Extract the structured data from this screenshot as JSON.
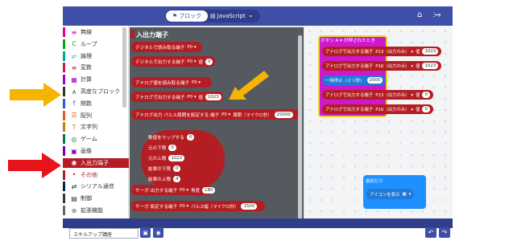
{
  "topbar": {
    "blocks_label": "ブロック",
    "js_label": "JavaScript",
    "home_icon": "home-icon",
    "share_icon": "share-icon"
  },
  "categories": [
    {
      "label": "無線",
      "color": "#e3008c",
      "icon": "bar-chart-icon"
    },
    {
      "label": "ループ",
      "color": "#00aa00",
      "icon": "loop-icon"
    },
    {
      "label": "論理",
      "color": "#00a4a6",
      "icon": "shuffle-icon"
    },
    {
      "label": "変数",
      "color": "#dc143c",
      "icon": "list-icon"
    },
    {
      "label": "計算",
      "color": "#9400d3",
      "icon": "grid-icon"
    },
    {
      "label": "高度なブロック",
      "color": "#333333",
      "icon": "chevron-up-icon"
    },
    {
      "label": "関数",
      "color": "#3455db",
      "icon": "function-icon"
    },
    {
      "label": "配列",
      "color": "#e65722",
      "icon": "array-icon"
    },
    {
      "label": "文字列",
      "color": "#b8860b",
      "icon": "text-icon"
    },
    {
      "label": "ゲーム",
      "color": "#007a4b",
      "icon": "game-icon"
    },
    {
      "label": "画像",
      "color": "#7600a8",
      "icon": "image-icon"
    },
    {
      "label": "入出力端子",
      "color": "#b41e23",
      "icon": "pin-icon"
    },
    {
      "label": "その他",
      "color": "#b41e23",
      "icon": "more-icon"
    },
    {
      "label": "シリアル通信",
      "color": "#002050",
      "icon": "serial-icon"
    },
    {
      "label": "制御",
      "color": "#333333",
      "icon": "control-icon"
    },
    {
      "label": "拡張機能",
      "color": "#666666",
      "icon": "plus-icon"
    }
  ],
  "flyout": {
    "title": "入出力端子",
    "blocks": [
      {
        "label": "デジタルで読み取る端子",
        "pin": "P0"
      },
      {
        "label": "デジタルで出力する端子",
        "pin": "P0",
        "suffix": "値",
        "value": "0"
      },
      {
        "label": "アナログ値を読み取る端子",
        "pin": "P0"
      },
      {
        "label": "アナログで出力する端子",
        "pin": "P0",
        "suffix": "値",
        "value": "1023"
      },
      {
        "label": "アナログ出力 パルス周期を設定する 端子",
        "pin": "P0",
        "suffix": "周期（マイクロ秒）",
        "value": "20000"
      },
      {
        "label": "サーボ 出力する端子",
        "pin": "P0",
        "suffix": "角度",
        "value": "180"
      },
      {
        "label": "サーボ 設定する端子",
        "pin": "P0",
        "suffix": "パルス幅（マイクロ秒）",
        "value": "1500"
      }
    ],
    "map_block": {
      "title": "数値をマップする",
      "value": "0",
      "rows": [
        {
          "label": "元の下限",
          "value": "0"
        },
        {
          "label": "元の上限",
          "value": "1023"
        },
        {
          "label": "結果の下限",
          "value": "0"
        },
        {
          "label": "結果の上限",
          "value": "4"
        }
      ]
    }
  },
  "workspace": {
    "event_label": "ボタン A ▾ が押されたとき",
    "event_blocks": [
      {
        "label": "アナログで出力する端子",
        "pin": "P13（出力のみ）",
        "suffix": "値",
        "value": "1023"
      },
      {
        "label": "アナログで出力する端子",
        "pin": "P16（出力のみ）",
        "suffix": "値",
        "value": "1023"
      },
      {
        "label": "一時停止（ミリ秒）",
        "value": "2000"
      },
      {
        "label": "アナログで出力する端子",
        "pin": "P13（出力のみ）",
        "suffix": "値",
        "value": "0"
      },
      {
        "label": "アナログで出力する端子",
        "pin": "P16（出力のみ）",
        "suffix": "値",
        "value": "0"
      }
    ],
    "forever_label": "最初だけ",
    "forever_inner": "アイコンを表示"
  },
  "bottombar": {
    "project_name": "スキルアップ講座",
    "save_icon": "save-icon",
    "github_icon": "github-icon",
    "undo_icon": "undo-icon",
    "redo_icon": "redo-icon"
  },
  "annotations": {
    "arrow_color": "#f5b400",
    "arrow_red_color": "#e8141b"
  }
}
